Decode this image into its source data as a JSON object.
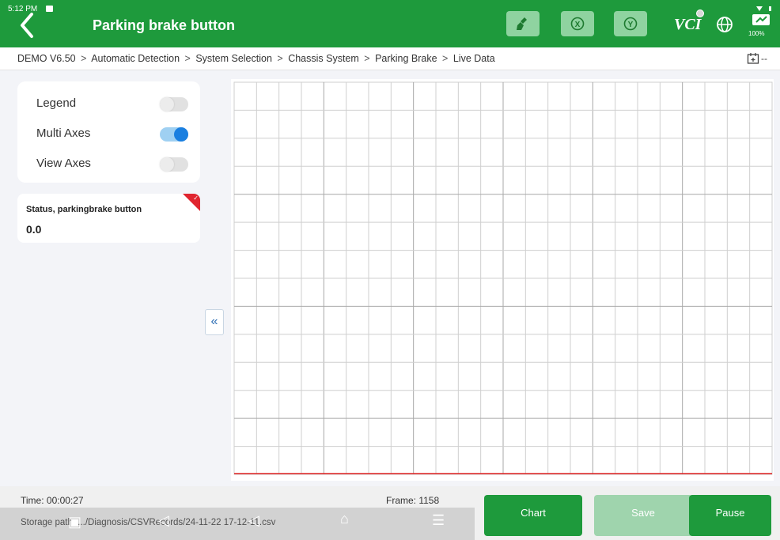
{
  "status_bar": {
    "time": "5:12 PM"
  },
  "header": {
    "title": "Parking brake button",
    "vci_label": "VCI",
    "battery_label": "100%"
  },
  "breadcrumb": {
    "items": [
      "DEMO V6.50",
      "Automatic Detection",
      "System Selection",
      "Chassis System",
      "Parking Brake",
      "Live Data"
    ],
    "right_text": "--"
  },
  "toggles": {
    "legend": {
      "label": "Legend",
      "on": false
    },
    "multi_axes": {
      "label": "Multi Axes",
      "on": true
    },
    "view_axes": {
      "label": "View Axes",
      "on": false
    }
  },
  "data_card": {
    "title": "Status, parkingbrake button",
    "value": "0.0"
  },
  "collapse_button": {
    "label": "«"
  },
  "chart_data": {
    "type": "line",
    "series": [
      {
        "x": [
          0,
          27
        ],
        "values": [
          0.0,
          0.0
        ],
        "color": "#e02020"
      }
    ],
    "title": "",
    "xlabel": "",
    "ylabel": "",
    "grid": true,
    "grid_color": "#cfcfcf",
    "grid_major_color": "#a8a8a8"
  },
  "footer": {
    "time": "Time: 00:00:27",
    "frame": "Frame: 1158",
    "storage": "Storage path:   .../Diagnosis/CSVRecords/24-11-22 17-12-11.csv"
  },
  "actions": {
    "chart": "Chart",
    "save": "Save",
    "pause": "Pause"
  },
  "colors": {
    "header_green": "#1e9a3c",
    "header_button": "#8fd3a0",
    "toggle_on": "#1a7fe0",
    "flag_red": "#e0252f"
  },
  "icons": {
    "back": "back-arrow-icon",
    "header_buttons": [
      "broom-icon",
      "clear-x-icon",
      "check-y-icon"
    ],
    "globe": "globe-icon",
    "battery": "battery-icon",
    "calendar": "calendar-icon"
  }
}
